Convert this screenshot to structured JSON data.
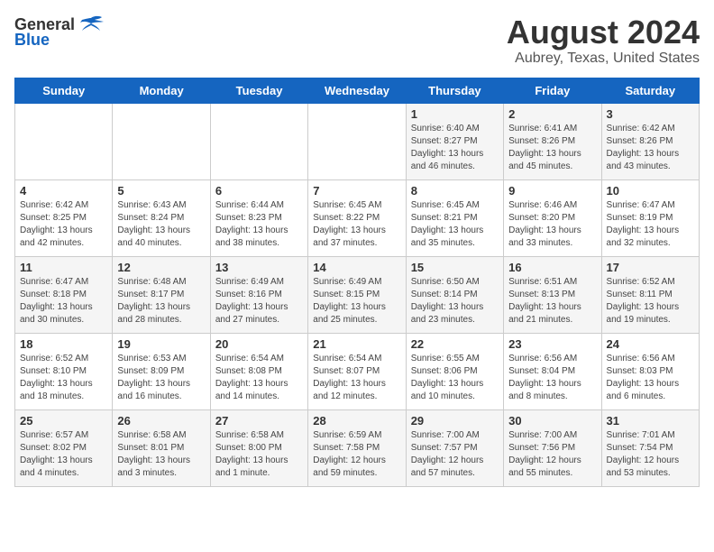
{
  "logo": {
    "general": "General",
    "blue": "Blue"
  },
  "title": "August 2024",
  "subtitle": "Aubrey, Texas, United States",
  "days": [
    "Sunday",
    "Monday",
    "Tuesday",
    "Wednesday",
    "Thursday",
    "Friday",
    "Saturday"
  ],
  "weeks": [
    [
      {
        "date": "",
        "sunrise": "",
        "sunset": "",
        "daylight": ""
      },
      {
        "date": "",
        "sunrise": "",
        "sunset": "",
        "daylight": ""
      },
      {
        "date": "",
        "sunrise": "",
        "sunset": "",
        "daylight": ""
      },
      {
        "date": "",
        "sunrise": "",
        "sunset": "",
        "daylight": ""
      },
      {
        "date": "1",
        "sunrise": "Sunrise: 6:40 AM",
        "sunset": "Sunset: 8:27 PM",
        "daylight": "Daylight: 13 hours and 46 minutes."
      },
      {
        "date": "2",
        "sunrise": "Sunrise: 6:41 AM",
        "sunset": "Sunset: 8:26 PM",
        "daylight": "Daylight: 13 hours and 45 minutes."
      },
      {
        "date": "3",
        "sunrise": "Sunrise: 6:42 AM",
        "sunset": "Sunset: 8:26 PM",
        "daylight": "Daylight: 13 hours and 43 minutes."
      }
    ],
    [
      {
        "date": "4",
        "sunrise": "Sunrise: 6:42 AM",
        "sunset": "Sunset: 8:25 PM",
        "daylight": "Daylight: 13 hours and 42 minutes."
      },
      {
        "date": "5",
        "sunrise": "Sunrise: 6:43 AM",
        "sunset": "Sunset: 8:24 PM",
        "daylight": "Daylight: 13 hours and 40 minutes."
      },
      {
        "date": "6",
        "sunrise": "Sunrise: 6:44 AM",
        "sunset": "Sunset: 8:23 PM",
        "daylight": "Daylight: 13 hours and 38 minutes."
      },
      {
        "date": "7",
        "sunrise": "Sunrise: 6:45 AM",
        "sunset": "Sunset: 8:22 PM",
        "daylight": "Daylight: 13 hours and 37 minutes."
      },
      {
        "date": "8",
        "sunrise": "Sunrise: 6:45 AM",
        "sunset": "Sunset: 8:21 PM",
        "daylight": "Daylight: 13 hours and 35 minutes."
      },
      {
        "date": "9",
        "sunrise": "Sunrise: 6:46 AM",
        "sunset": "Sunset: 8:20 PM",
        "daylight": "Daylight: 13 hours and 33 minutes."
      },
      {
        "date": "10",
        "sunrise": "Sunrise: 6:47 AM",
        "sunset": "Sunset: 8:19 PM",
        "daylight": "Daylight: 13 hours and 32 minutes."
      }
    ],
    [
      {
        "date": "11",
        "sunrise": "Sunrise: 6:47 AM",
        "sunset": "Sunset: 8:18 PM",
        "daylight": "Daylight: 13 hours and 30 minutes."
      },
      {
        "date": "12",
        "sunrise": "Sunrise: 6:48 AM",
        "sunset": "Sunset: 8:17 PM",
        "daylight": "Daylight: 13 hours and 28 minutes."
      },
      {
        "date": "13",
        "sunrise": "Sunrise: 6:49 AM",
        "sunset": "Sunset: 8:16 PM",
        "daylight": "Daylight: 13 hours and 27 minutes."
      },
      {
        "date": "14",
        "sunrise": "Sunrise: 6:49 AM",
        "sunset": "Sunset: 8:15 PM",
        "daylight": "Daylight: 13 hours and 25 minutes."
      },
      {
        "date": "15",
        "sunrise": "Sunrise: 6:50 AM",
        "sunset": "Sunset: 8:14 PM",
        "daylight": "Daylight: 13 hours and 23 minutes."
      },
      {
        "date": "16",
        "sunrise": "Sunrise: 6:51 AM",
        "sunset": "Sunset: 8:13 PM",
        "daylight": "Daylight: 13 hours and 21 minutes."
      },
      {
        "date": "17",
        "sunrise": "Sunrise: 6:52 AM",
        "sunset": "Sunset: 8:11 PM",
        "daylight": "Daylight: 13 hours and 19 minutes."
      }
    ],
    [
      {
        "date": "18",
        "sunrise": "Sunrise: 6:52 AM",
        "sunset": "Sunset: 8:10 PM",
        "daylight": "Daylight: 13 hours and 18 minutes."
      },
      {
        "date": "19",
        "sunrise": "Sunrise: 6:53 AM",
        "sunset": "Sunset: 8:09 PM",
        "daylight": "Daylight: 13 hours and 16 minutes."
      },
      {
        "date": "20",
        "sunrise": "Sunrise: 6:54 AM",
        "sunset": "Sunset: 8:08 PM",
        "daylight": "Daylight: 13 hours and 14 minutes."
      },
      {
        "date": "21",
        "sunrise": "Sunrise: 6:54 AM",
        "sunset": "Sunset: 8:07 PM",
        "daylight": "Daylight: 13 hours and 12 minutes."
      },
      {
        "date": "22",
        "sunrise": "Sunrise: 6:55 AM",
        "sunset": "Sunset: 8:06 PM",
        "daylight": "Daylight: 13 hours and 10 minutes."
      },
      {
        "date": "23",
        "sunrise": "Sunrise: 6:56 AM",
        "sunset": "Sunset: 8:04 PM",
        "daylight": "Daylight: 13 hours and 8 minutes."
      },
      {
        "date": "24",
        "sunrise": "Sunrise: 6:56 AM",
        "sunset": "Sunset: 8:03 PM",
        "daylight": "Daylight: 13 hours and 6 minutes."
      }
    ],
    [
      {
        "date": "25",
        "sunrise": "Sunrise: 6:57 AM",
        "sunset": "Sunset: 8:02 PM",
        "daylight": "Daylight: 13 hours and 4 minutes."
      },
      {
        "date": "26",
        "sunrise": "Sunrise: 6:58 AM",
        "sunset": "Sunset: 8:01 PM",
        "daylight": "Daylight: 13 hours and 3 minutes."
      },
      {
        "date": "27",
        "sunrise": "Sunrise: 6:58 AM",
        "sunset": "Sunset: 8:00 PM",
        "daylight": "Daylight: 13 hours and 1 minute."
      },
      {
        "date": "28",
        "sunrise": "Sunrise: 6:59 AM",
        "sunset": "Sunset: 7:58 PM",
        "daylight": "Daylight: 12 hours and 59 minutes."
      },
      {
        "date": "29",
        "sunrise": "Sunrise: 7:00 AM",
        "sunset": "Sunset: 7:57 PM",
        "daylight": "Daylight: 12 hours and 57 minutes."
      },
      {
        "date": "30",
        "sunrise": "Sunrise: 7:00 AM",
        "sunset": "Sunset: 7:56 PM",
        "daylight": "Daylight: 12 hours and 55 minutes."
      },
      {
        "date": "31",
        "sunrise": "Sunrise: 7:01 AM",
        "sunset": "Sunset: 7:54 PM",
        "daylight": "Daylight: 12 hours and 53 minutes."
      }
    ]
  ]
}
